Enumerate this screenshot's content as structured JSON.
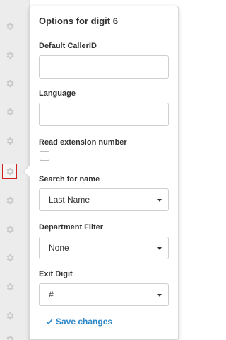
{
  "sidebar": {
    "digits": [
      {
        "icon": "gear-icon",
        "selected": false
      },
      {
        "icon": "gear-icon",
        "selected": false
      },
      {
        "icon": "gear-icon",
        "selected": false
      },
      {
        "icon": "gear-icon",
        "selected": false
      },
      {
        "icon": "gear-icon",
        "selected": false
      },
      {
        "icon": "gear-icon",
        "selected": false
      },
      {
        "icon": "gear-icon",
        "selected": true
      },
      {
        "icon": "gear-icon",
        "selected": false
      },
      {
        "icon": "gear-icon",
        "selected": false
      },
      {
        "icon": "gear-icon",
        "selected": false
      },
      {
        "icon": "gear-icon",
        "selected": false
      },
      {
        "icon": "gear-icon",
        "selected": false
      }
    ],
    "selected_color": "#cc2222"
  },
  "popover": {
    "title": "Options for digit 6",
    "default_callerid": {
      "label": "Default CallerID",
      "value": ""
    },
    "language": {
      "label": "Language",
      "value": ""
    },
    "read_extension": {
      "label": "Read extension number",
      "checked": false
    },
    "search_for_name": {
      "label": "Search for name",
      "selected": "Last Name"
    },
    "department_filter": {
      "label": "Department Filter",
      "selected": "None"
    },
    "exit_digit": {
      "label": "Exit Digit",
      "selected": "#"
    },
    "save": {
      "label": "Save changes",
      "icon": "check-icon",
      "color": "#2d87c7"
    }
  }
}
